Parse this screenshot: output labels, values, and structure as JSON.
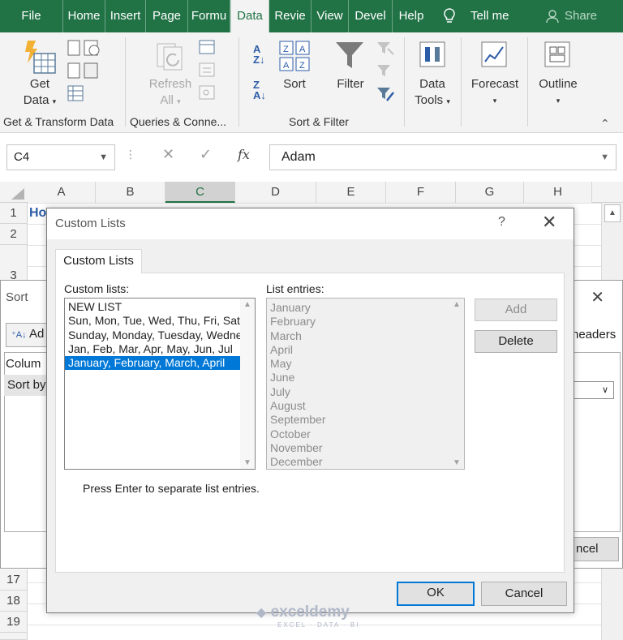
{
  "tabs": [
    "File",
    "Home",
    "Insert",
    "Page",
    "Formu",
    "Data",
    "Revie",
    "View",
    "Devel",
    "Help"
  ],
  "active_tab": "Data",
  "tell_me": "Tell me",
  "share": "Share",
  "ribbon": {
    "get_data": "Get",
    "get_data_2": "Data",
    "refresh": "Refresh",
    "refresh_2": "All",
    "sort": "Sort",
    "filter": "Filter",
    "data_tools": "Data",
    "data_tools_2": "Tools",
    "forecast": "Forecast",
    "outline": "Outline",
    "groups": [
      "Get & Transform Data",
      "Queries & Conne...",
      "Sort & Filter"
    ]
  },
  "formula_bar": {
    "name_box": "C4",
    "fx": "fx",
    "value": "Adam"
  },
  "grid": {
    "columns": [
      "A",
      "B",
      "C",
      "D",
      "E",
      "F",
      "G",
      "H"
    ],
    "selected_column": "C",
    "rows": [
      "1",
      "2",
      "3",
      "17",
      "18",
      "19"
    ],
    "cell_a1": "Ho"
  },
  "sort_dialog": {
    "title": "Sort",
    "add_level": "Ad",
    "headers": "headers",
    "column_header": "Colum",
    "sort_by": "Sort by",
    "cancel": "ncel"
  },
  "custom_lists": {
    "title": "Custom Lists",
    "help": "?",
    "tab": "Custom Lists",
    "lists_label": "Custom lists:",
    "entries_label": "List entries:",
    "lists": [
      "NEW LIST",
      "Sun, Mon, Tue, Wed, Thu, Fri, Sat",
      "Sunday, Monday, Tuesday, Wednesday",
      "Jan, Feb, Mar, Apr, May, Jun, Jul",
      "January, February, March, April"
    ],
    "selected_index": 4,
    "entries": [
      "January",
      "February",
      "March",
      "April",
      "May",
      "June",
      "July",
      "August",
      "September",
      "October",
      "November",
      "December"
    ],
    "add": "Add",
    "delete": "Delete",
    "hint": "Press Enter to separate list entries.",
    "ok": "OK",
    "cancel": "Cancel"
  },
  "watermark": {
    "name": "exceldemy",
    "tagline": "EXCEL · DATA · BI"
  },
  "colors": {
    "excel_green": "#217346",
    "selection_blue": "#0078d7"
  }
}
